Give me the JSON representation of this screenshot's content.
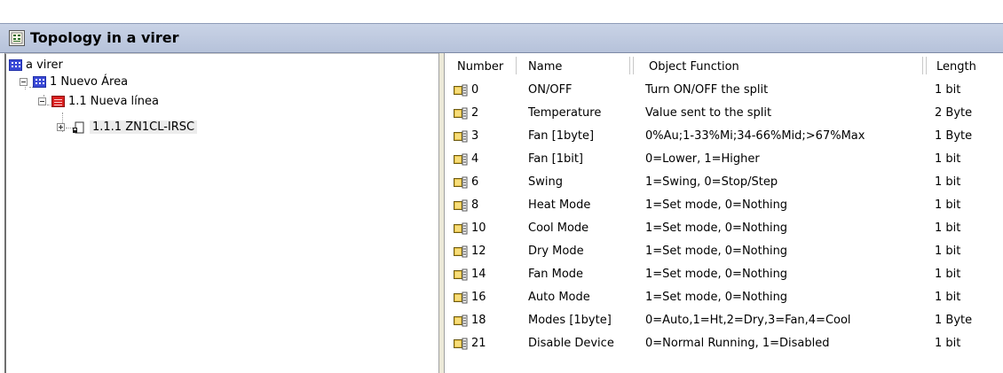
{
  "window": {
    "title": "Topology in a virer"
  },
  "tree": {
    "root": {
      "label": "a virer"
    },
    "area": {
      "label": "1 Nuevo Área"
    },
    "line": {
      "label": "1.1 Nueva línea"
    },
    "device": {
      "label": "1.1.1 ZN1CL-IRSC"
    }
  },
  "table": {
    "columns": [
      "Number",
      "Name",
      "Object Function",
      "Length"
    ],
    "rows": [
      {
        "number": "0",
        "name": "ON/OFF",
        "function": "Turn ON/OFF the split",
        "length": "1 bit"
      },
      {
        "number": "2",
        "name": "Temperature",
        "function": "Value sent to the split",
        "length": "2 Byte"
      },
      {
        "number": "3",
        "name": "Fan [1byte]",
        "function": "0%Au;1-33%Mi;34-66%Mid;>67%Max",
        "length": "1 Byte"
      },
      {
        "number": "4",
        "name": "Fan [1bit]",
        "function": "0=Lower, 1=Higher",
        "length": "1 bit"
      },
      {
        "number": "6",
        "name": "Swing",
        "function": "1=Swing, 0=Stop/Step",
        "length": "1 bit"
      },
      {
        "number": "8",
        "name": "Heat Mode",
        "function": "1=Set mode, 0=Nothing",
        "length": "1 bit"
      },
      {
        "number": "10",
        "name": "Cool Mode",
        "function": "1=Set mode, 0=Nothing",
        "length": "1 bit"
      },
      {
        "number": "12",
        "name": "Dry Mode",
        "function": "1=Set mode, 0=Nothing",
        "length": "1 bit"
      },
      {
        "number": "14",
        "name": "Fan Mode",
        "function": "1=Set mode, 0=Nothing",
        "length": "1 bit"
      },
      {
        "number": "16",
        "name": "Auto Mode",
        "function": "1=Set mode, 0=Nothing",
        "length": "1 bit"
      },
      {
        "number": "18",
        "name": "Modes [1byte]",
        "function": "0=Auto,1=Ht,2=Dry,3=Fan,4=Cool",
        "length": "1 Byte"
      },
      {
        "number": "21",
        "name": "Disable Device",
        "function": "0=Normal Running, 1=Disabled",
        "length": "1 bit"
      }
    ]
  },
  "colors": {
    "titlebar": "#b6c2da",
    "area_icon": "#3b4ad6",
    "line_icon": "#d92020",
    "object_icon": "#e8c24a"
  },
  "icons": {
    "window": "topology-window-icon",
    "area": "area-icon",
    "line": "line-icon",
    "device": "device-icon",
    "object": "group-object-icon"
  }
}
